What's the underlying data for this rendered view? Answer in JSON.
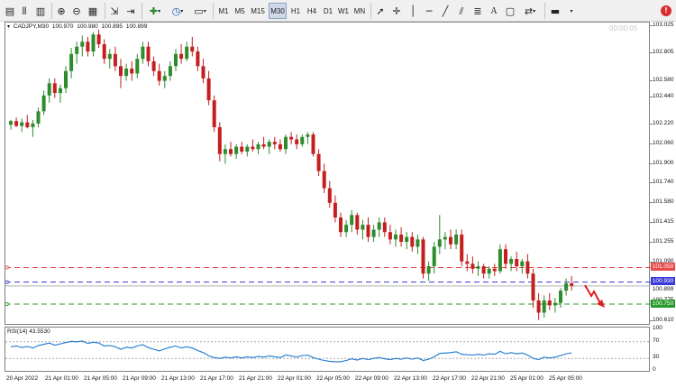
{
  "toolbar": {
    "timeframes": [
      "M1",
      "M5",
      "M15",
      "M30",
      "H1",
      "H4",
      "D1",
      "W1",
      "MN"
    ],
    "active_timeframe": "M30"
  },
  "chart": {
    "symbol": "CADJPY,M30",
    "open": "100.970",
    "high": "100.980",
    "low": "100.895",
    "close": "100.899",
    "timer": "00:00:05",
    "price_axis_labels": [
      "103.025",
      "102.805",
      "102.580",
      "102.440",
      "102.220",
      "102.060",
      "101.900",
      "101.740",
      "101.580",
      "101.415",
      "101.255",
      "101.090",
      "100.930",
      "100.775",
      "100.610"
    ],
    "lines": {
      "red": "101.050",
      "blue": "100.930",
      "bid": "100.899",
      "green": "100.750"
    },
    "colors": {
      "bull": "#2e8b2e",
      "bear": "#c41e1e",
      "red_line": "#e84a4a",
      "blue_line": "#3a3ad8",
      "green_line": "#2a9a2a",
      "rsi_line": "#1e78d2"
    }
  },
  "rsi": {
    "label": "RSI(14) 43.5530",
    "levels": [
      "70",
      "30",
      "0"
    ],
    "level_100": "100"
  },
  "time_axis": {
    "labels": [
      "20 Apr 2022",
      "21 Apr 01:00",
      "21 Apr 05:00",
      "21 Apr 09:00",
      "21 Apr 13:00",
      "21 Apr 17:00",
      "21 Apr 21:00",
      "22 Apr 01:00",
      "22 Apr 05:00",
      "22 Apr 09:00",
      "22 Apr 13:00",
      "22 Apr 17:00",
      "22 Apr 21:00",
      "25 Apr 01:00",
      "25 Apr 05:00"
    ]
  },
  "chart_data": {
    "type": "candlestick",
    "candles": [
      [
        102.22,
        102.26,
        102.18,
        102.25
      ],
      [
        102.25,
        102.28,
        102.2,
        102.21
      ],
      [
        102.21,
        102.27,
        102.16,
        102.24
      ],
      [
        102.24,
        102.3,
        102.19,
        102.2
      ],
      [
        102.2,
        102.26,
        102.12,
        102.23
      ],
      [
        102.23,
        102.36,
        102.2,
        102.33
      ],
      [
        102.33,
        102.5,
        102.3,
        102.46
      ],
      [
        102.46,
        102.6,
        102.4,
        102.56
      ],
      [
        102.56,
        102.6,
        102.44,
        102.48
      ],
      [
        102.48,
        102.55,
        102.4,
        102.52
      ],
      [
        102.52,
        102.7,
        102.48,
        102.66
      ],
      [
        102.66,
        102.85,
        102.6,
        102.8
      ],
      [
        102.8,
        102.9,
        102.72,
        102.86
      ],
      [
        102.86,
        102.95,
        102.78,
        102.9
      ],
      [
        102.9,
        102.94,
        102.78,
        102.82
      ],
      [
        102.82,
        102.98,
        102.78,
        102.96
      ],
      [
        102.96,
        103.0,
        102.85,
        102.88
      ],
      [
        102.88,
        102.92,
        102.72,
        102.76
      ],
      [
        102.76,
        102.84,
        102.68,
        102.8
      ],
      [
        102.8,
        102.86,
        102.66,
        102.7
      ],
      [
        102.7,
        102.76,
        102.52,
        102.62
      ],
      [
        102.62,
        102.72,
        102.58,
        102.68
      ],
      [
        102.68,
        102.74,
        102.58,
        102.64
      ],
      [
        102.64,
        102.8,
        102.6,
        102.76
      ],
      [
        102.76,
        102.9,
        102.72,
        102.86
      ],
      [
        102.86,
        102.9,
        102.7,
        102.74
      ],
      [
        102.74,
        102.78,
        102.62,
        102.66
      ],
      [
        102.66,
        102.72,
        102.54,
        102.58
      ],
      [
        102.58,
        102.66,
        102.52,
        102.62
      ],
      [
        102.62,
        102.74,
        102.58,
        102.7
      ],
      [
        102.7,
        102.84,
        102.66,
        102.8
      ],
      [
        102.8,
        102.88,
        102.72,
        102.76
      ],
      [
        102.76,
        102.9,
        102.74,
        102.86
      ],
      [
        102.86,
        102.94,
        102.78,
        102.82
      ],
      [
        102.82,
        102.86,
        102.66,
        102.7
      ],
      [
        102.7,
        102.76,
        102.56,
        102.6
      ],
      [
        102.6,
        102.66,
        102.38,
        102.42
      ],
      [
        102.42,
        102.46,
        102.16,
        102.2
      ],
      [
        102.2,
        102.24,
        101.92,
        101.98
      ],
      [
        101.98,
        102.06,
        101.9,
        102.02
      ],
      [
        102.02,
        102.08,
        101.96,
        101.98
      ],
      [
        101.98,
        102.06,
        101.94,
        102.04
      ],
      [
        102.04,
        102.08,
        101.98,
        102.0
      ],
      [
        102.0,
        102.06,
        101.96,
        102.04
      ],
      [
        102.04,
        102.1,
        102.0,
        102.02
      ],
      [
        102.02,
        102.08,
        101.98,
        102.06
      ],
      [
        102.06,
        102.12,
        102.02,
        102.04
      ],
      [
        102.04,
        102.1,
        101.98,
        102.08
      ],
      [
        102.08,
        102.12,
        102.02,
        102.06
      ],
      [
        102.06,
        102.1,
        102.0,
        102.02
      ],
      [
        102.02,
        102.14,
        101.98,
        102.12
      ],
      [
        102.12,
        102.16,
        102.06,
        102.1
      ],
      [
        102.1,
        102.14,
        102.02,
        102.06
      ],
      [
        102.06,
        102.14,
        102.04,
        102.12
      ],
      [
        102.12,
        102.16,
        102.06,
        102.14
      ],
      [
        102.14,
        102.16,
        101.96,
        101.98
      ],
      [
        101.98,
        102.02,
        101.8,
        101.84
      ],
      [
        101.84,
        101.9,
        101.66,
        101.7
      ],
      [
        101.7,
        101.76,
        101.54,
        101.58
      ],
      [
        101.58,
        101.64,
        101.42,
        101.46
      ],
      [
        101.46,
        101.5,
        101.3,
        101.34
      ],
      [
        101.34,
        101.44,
        101.3,
        101.4
      ],
      [
        101.4,
        101.52,
        101.34,
        101.48
      ],
      [
        101.48,
        101.5,
        101.32,
        101.36
      ],
      [
        101.36,
        101.44,
        101.28,
        101.4
      ],
      [
        101.4,
        101.46,
        101.26,
        101.3
      ],
      [
        101.3,
        101.4,
        101.26,
        101.36
      ],
      [
        101.36,
        101.46,
        101.3,
        101.42
      ],
      [
        101.42,
        101.46,
        101.3,
        101.34
      ],
      [
        101.34,
        101.4,
        101.24,
        101.28
      ],
      [
        101.28,
        101.36,
        101.22,
        101.32
      ],
      [
        101.32,
        101.38,
        101.22,
        101.26
      ],
      [
        101.26,
        101.34,
        101.2,
        101.3
      ],
      [
        101.3,
        101.34,
        101.18,
        101.22
      ],
      [
        101.22,
        101.32,
        101.16,
        101.28
      ],
      [
        101.28,
        101.3,
        100.96,
        101.0
      ],
      [
        101.0,
        101.1,
        100.94,
        101.06
      ],
      [
        101.06,
        101.26,
        101.0,
        101.22
      ],
      [
        101.22,
        101.48,
        101.16,
        101.28
      ],
      [
        101.28,
        101.34,
        101.2,
        101.3
      ],
      [
        101.3,
        101.36,
        101.2,
        101.24
      ],
      [
        101.24,
        101.36,
        101.2,
        101.32
      ],
      [
        101.32,
        101.36,
        101.06,
        101.1
      ],
      [
        101.1,
        101.16,
        101.02,
        101.08
      ],
      [
        101.08,
        101.14,
        101.0,
        101.04
      ],
      [
        101.04,
        101.1,
        100.98,
        101.06
      ],
      [
        101.06,
        101.08,
        100.96,
        101.0
      ],
      [
        101.0,
        101.06,
        100.96,
        101.04
      ],
      [
        101.04,
        101.08,
        100.98,
        101.02
      ],
      [
        101.02,
        101.24,
        101.0,
        101.2
      ],
      [
        101.2,
        101.24,
        101.04,
        101.08
      ],
      [
        101.08,
        101.14,
        101.02,
        101.12
      ],
      [
        101.12,
        101.18,
        101.02,
        101.06
      ],
      [
        101.06,
        101.12,
        101.0,
        101.1
      ],
      [
        101.1,
        101.16,
        100.96,
        101.0
      ],
      [
        101.0,
        101.04,
        100.72,
        100.78
      ],
      [
        100.78,
        100.84,
        100.62,
        100.68
      ],
      [
        100.68,
        100.82,
        100.64,
        100.78
      ],
      [
        100.78,
        100.84,
        100.7,
        100.74
      ],
      [
        100.74,
        100.8,
        100.68,
        100.76
      ],
      [
        100.76,
        100.88,
        100.72,
        100.86
      ],
      [
        100.86,
        100.96,
        100.82,
        100.92
      ],
      [
        100.92,
        100.98,
        100.86,
        100.9
      ]
    ],
    "rsi": [
      58,
      60,
      56,
      59,
      55,
      61,
      64,
      67,
      62,
      65,
      68,
      71,
      70,
      72,
      66,
      69,
      67,
      60,
      61,
      58,
      52,
      57,
      55,
      60,
      63,
      56,
      52,
      48,
      53,
      57,
      60,
      55,
      58,
      55,
      49,
      44,
      36,
      32,
      30,
      33,
      31,
      34,
      31,
      34,
      32,
      35,
      33,
      36,
      34,
      32,
      38,
      36,
      33,
      37,
      38,
      32,
      28,
      25,
      23,
      22,
      22,
      25,
      29,
      26,
      30,
      27,
      30,
      32,
      29,
      27,
      30,
      28,
      31,
      28,
      31,
      25,
      28,
      34,
      42,
      43,
      44,
      46,
      40,
      39,
      38,
      40,
      38,
      41,
      40,
      47,
      41,
      44,
      41,
      43,
      38,
      30,
      27,
      33,
      31,
      33,
      37,
      41,
      43.553
    ],
    "price_range": [
      100.58,
      103.05
    ],
    "rsi_range": [
      0,
      100
    ]
  }
}
